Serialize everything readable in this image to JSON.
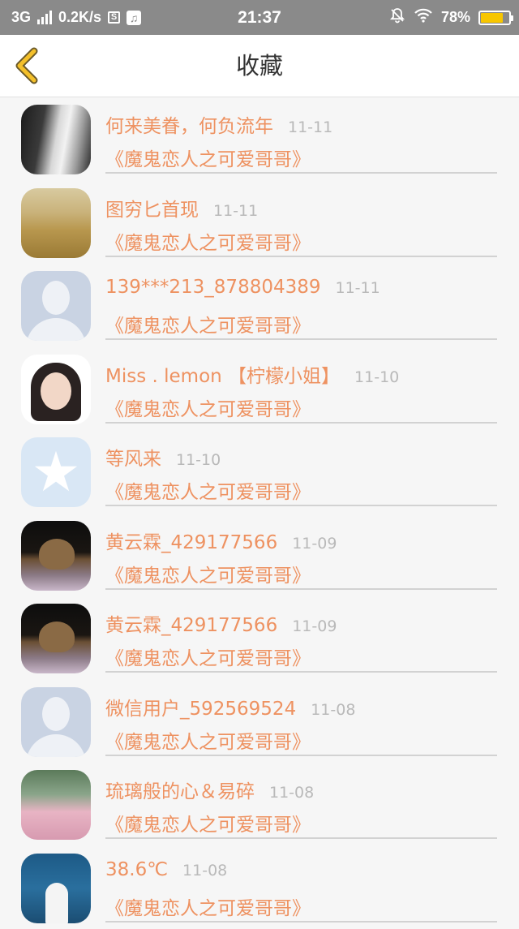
{
  "status_bar": {
    "network": "3G",
    "speed": "0.2K/s",
    "s_badge": "S",
    "time": "21:37",
    "battery": "78%",
    "battery_level": 0.78
  },
  "header": {
    "title": "收藏"
  },
  "items": [
    {
      "name": "何来美眷，何负流年",
      "date": "11-11",
      "title": "《魔鬼恋人之可爱哥哥》"
    },
    {
      "name": "图穷匕首现",
      "date": "11-11",
      "title": "《魔鬼恋人之可爱哥哥》"
    },
    {
      "name": "139***213_878804389",
      "date": "11-11",
      "title": "《魔鬼恋人之可爱哥哥》"
    },
    {
      "name": "Miss . lemon 【柠檬小姐】",
      "date": "11-10",
      "title": "《魔鬼恋人之可爱哥哥》"
    },
    {
      "name": "等风来",
      "date": "11-10",
      "title": "《魔鬼恋人之可爱哥哥》"
    },
    {
      "name": "黄云霖_429177566",
      "date": "11-09",
      "title": "《魔鬼恋人之可爱哥哥》"
    },
    {
      "name": "黄云霖_429177566",
      "date": "11-09",
      "title": "《魔鬼恋人之可爱哥哥》"
    },
    {
      "name": "微信用户_592569524",
      "date": "11-08",
      "title": "《魔鬼恋人之可爱哥哥》"
    },
    {
      "name": "琉璃般的心＆易碎",
      "date": "11-08",
      "title": "《魔鬼恋人之可爱哥哥》"
    },
    {
      "name": "38.6℃",
      "date": "11-08",
      "title": "《魔鬼恋人之可爱哥哥》"
    }
  ],
  "colors": {
    "accent": "#ee9261",
    "back_arrow": "#f4c02a",
    "status_bar": "#8a8a8a"
  }
}
